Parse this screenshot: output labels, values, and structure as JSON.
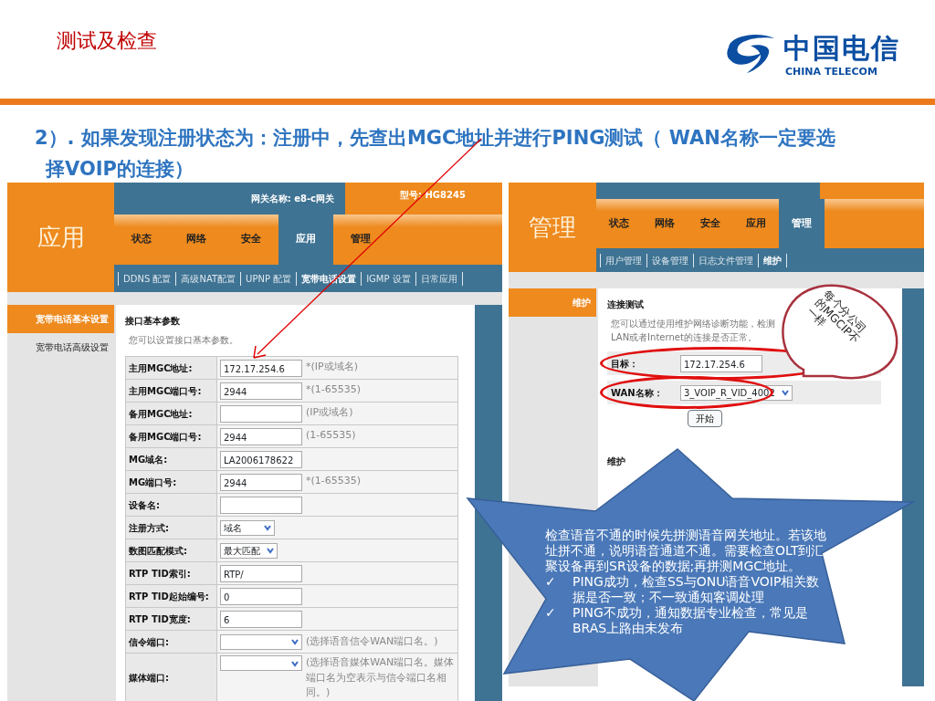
{
  "slide": {
    "title": "测试及检查",
    "logo": {
      "name_cn": "中国电信",
      "name_en": "CHINA TELECOM"
    },
    "instruction": "2）. 如果发现注册状态为：注册中，先查出MGC地址并进行PING测试（  WAN名称一定要选择VOIP的连接）"
  },
  "left_screen": {
    "header_title": "应用",
    "gateway_name": "网关名称: e8-c网关",
    "model": "型号: HG8245",
    "tabs": [
      {
        "label": "状态",
        "selected": false
      },
      {
        "label": "网络",
        "selected": false
      },
      {
        "label": "安全",
        "selected": false
      },
      {
        "label": "应用",
        "selected": true
      },
      {
        "label": "管理",
        "selected": false
      }
    ],
    "subnav": [
      {
        "label": "DDNS 配置",
        "selected": false
      },
      {
        "label": "高级NAT配置",
        "selected": false
      },
      {
        "label": "UPNP 配置",
        "selected": false
      },
      {
        "label": "宽带电话设置",
        "selected": true
      },
      {
        "label": "IGMP 设置",
        "selected": false
      },
      {
        "label": "日常应用",
        "selected": false
      }
    ],
    "sidebar": [
      {
        "label": "宽带电话基本设置",
        "selected": true
      },
      {
        "label": "宽带电话高级设置",
        "selected": false
      }
    ],
    "section_title": "接口基本参数",
    "section_hint": "您可以设置接口基本参数。",
    "fields": [
      {
        "label": "主用MGC地址:",
        "kind": "input",
        "value": "172.17.254.6",
        "hint": "*(IP或域名)"
      },
      {
        "label": "主用MGC端口号:",
        "kind": "input",
        "value": "2944",
        "hint": "*(1-65535)"
      },
      {
        "label": "备用MGC地址:",
        "kind": "input",
        "hint": "(IP或域名)"
      },
      {
        "label": "备用MGC端口号:",
        "kind": "input",
        "value": "2944",
        "hint": "(1-65535)"
      },
      {
        "label": "MG域名:",
        "kind": "input",
        "value": "LA2006178622"
      },
      {
        "label": "MG端口号:",
        "kind": "input",
        "value": "2944",
        "hint": "*(1-65535)"
      },
      {
        "label": "设备名:",
        "kind": "input"
      },
      {
        "label": "注册方式:",
        "kind": "select",
        "value": "域名"
      },
      {
        "label": "数图匹配模式:",
        "kind": "select",
        "value": "最大匹配"
      },
      {
        "label": "RTP TID索引:",
        "kind": "input",
        "value": "RTP/"
      },
      {
        "label": "RTP TID起始编号:",
        "kind": "input",
        "value": "0"
      },
      {
        "label": "RTP TID宽度:",
        "kind": "input",
        "value": "6"
      },
      {
        "label": "信令端口:",
        "kind": "select",
        "hint": "(选择语音信令WAN端口名。)"
      },
      {
        "label": "媒体端口:",
        "kind": "select",
        "hint": "(选择语音媒体WAN端口名。媒体端口名为空表示与信令端口名相同。)"
      }
    ]
  },
  "right_screen": {
    "header_title": "管理",
    "tabs": [
      {
        "label": "状态",
        "selected": false
      },
      {
        "label": "网络",
        "selected": false
      },
      {
        "label": "安全",
        "selected": false
      },
      {
        "label": "应用",
        "selected": false
      },
      {
        "label": "管理",
        "selected": true
      }
    ],
    "subnav": [
      {
        "label": "用户管理",
        "selected": false
      },
      {
        "label": "设备管理",
        "selected": false
      },
      {
        "label": "日志文件管理",
        "selected": false
      },
      {
        "label": "维护",
        "selected": true
      }
    ],
    "sidebar": [
      {
        "label": "维护",
        "selected": true
      }
    ],
    "section_title": "连接测试",
    "section_hint": "您可以通过使用维护网络诊断功能，检测LAN或者Internet的连接是否正常。",
    "fields": [
      {
        "label": "目标：",
        "kind": "input",
        "value": "172.17.254.6",
        "highlighted": true
      },
      {
        "label": "WAN名称：",
        "kind": "select",
        "value": "3_VOIP_R_VID_4002",
        "highlighted": true
      }
    ],
    "button": "开始",
    "section2_title": "维护"
  },
  "speech_bubble": "每个分公司的MGCIP不一样",
  "callout": {
    "text": "检查语音不通的时候先拼测语音网关地址。若该地址拼不通，说明语音通道不通。需要检查OLT到汇聚设备再到SR设备的数据;再拼测MGC地址。",
    "bullets": [
      {
        "mark": "✓",
        "text": "PING成功，检查SS与ONU语音VOIP相关数据是否一致；不一致通知客调处理"
      },
      {
        "mark": "✓",
        "text": "PING不成功，通知数据专业检查，常见是BRAS上路由未发布"
      }
    ]
  }
}
